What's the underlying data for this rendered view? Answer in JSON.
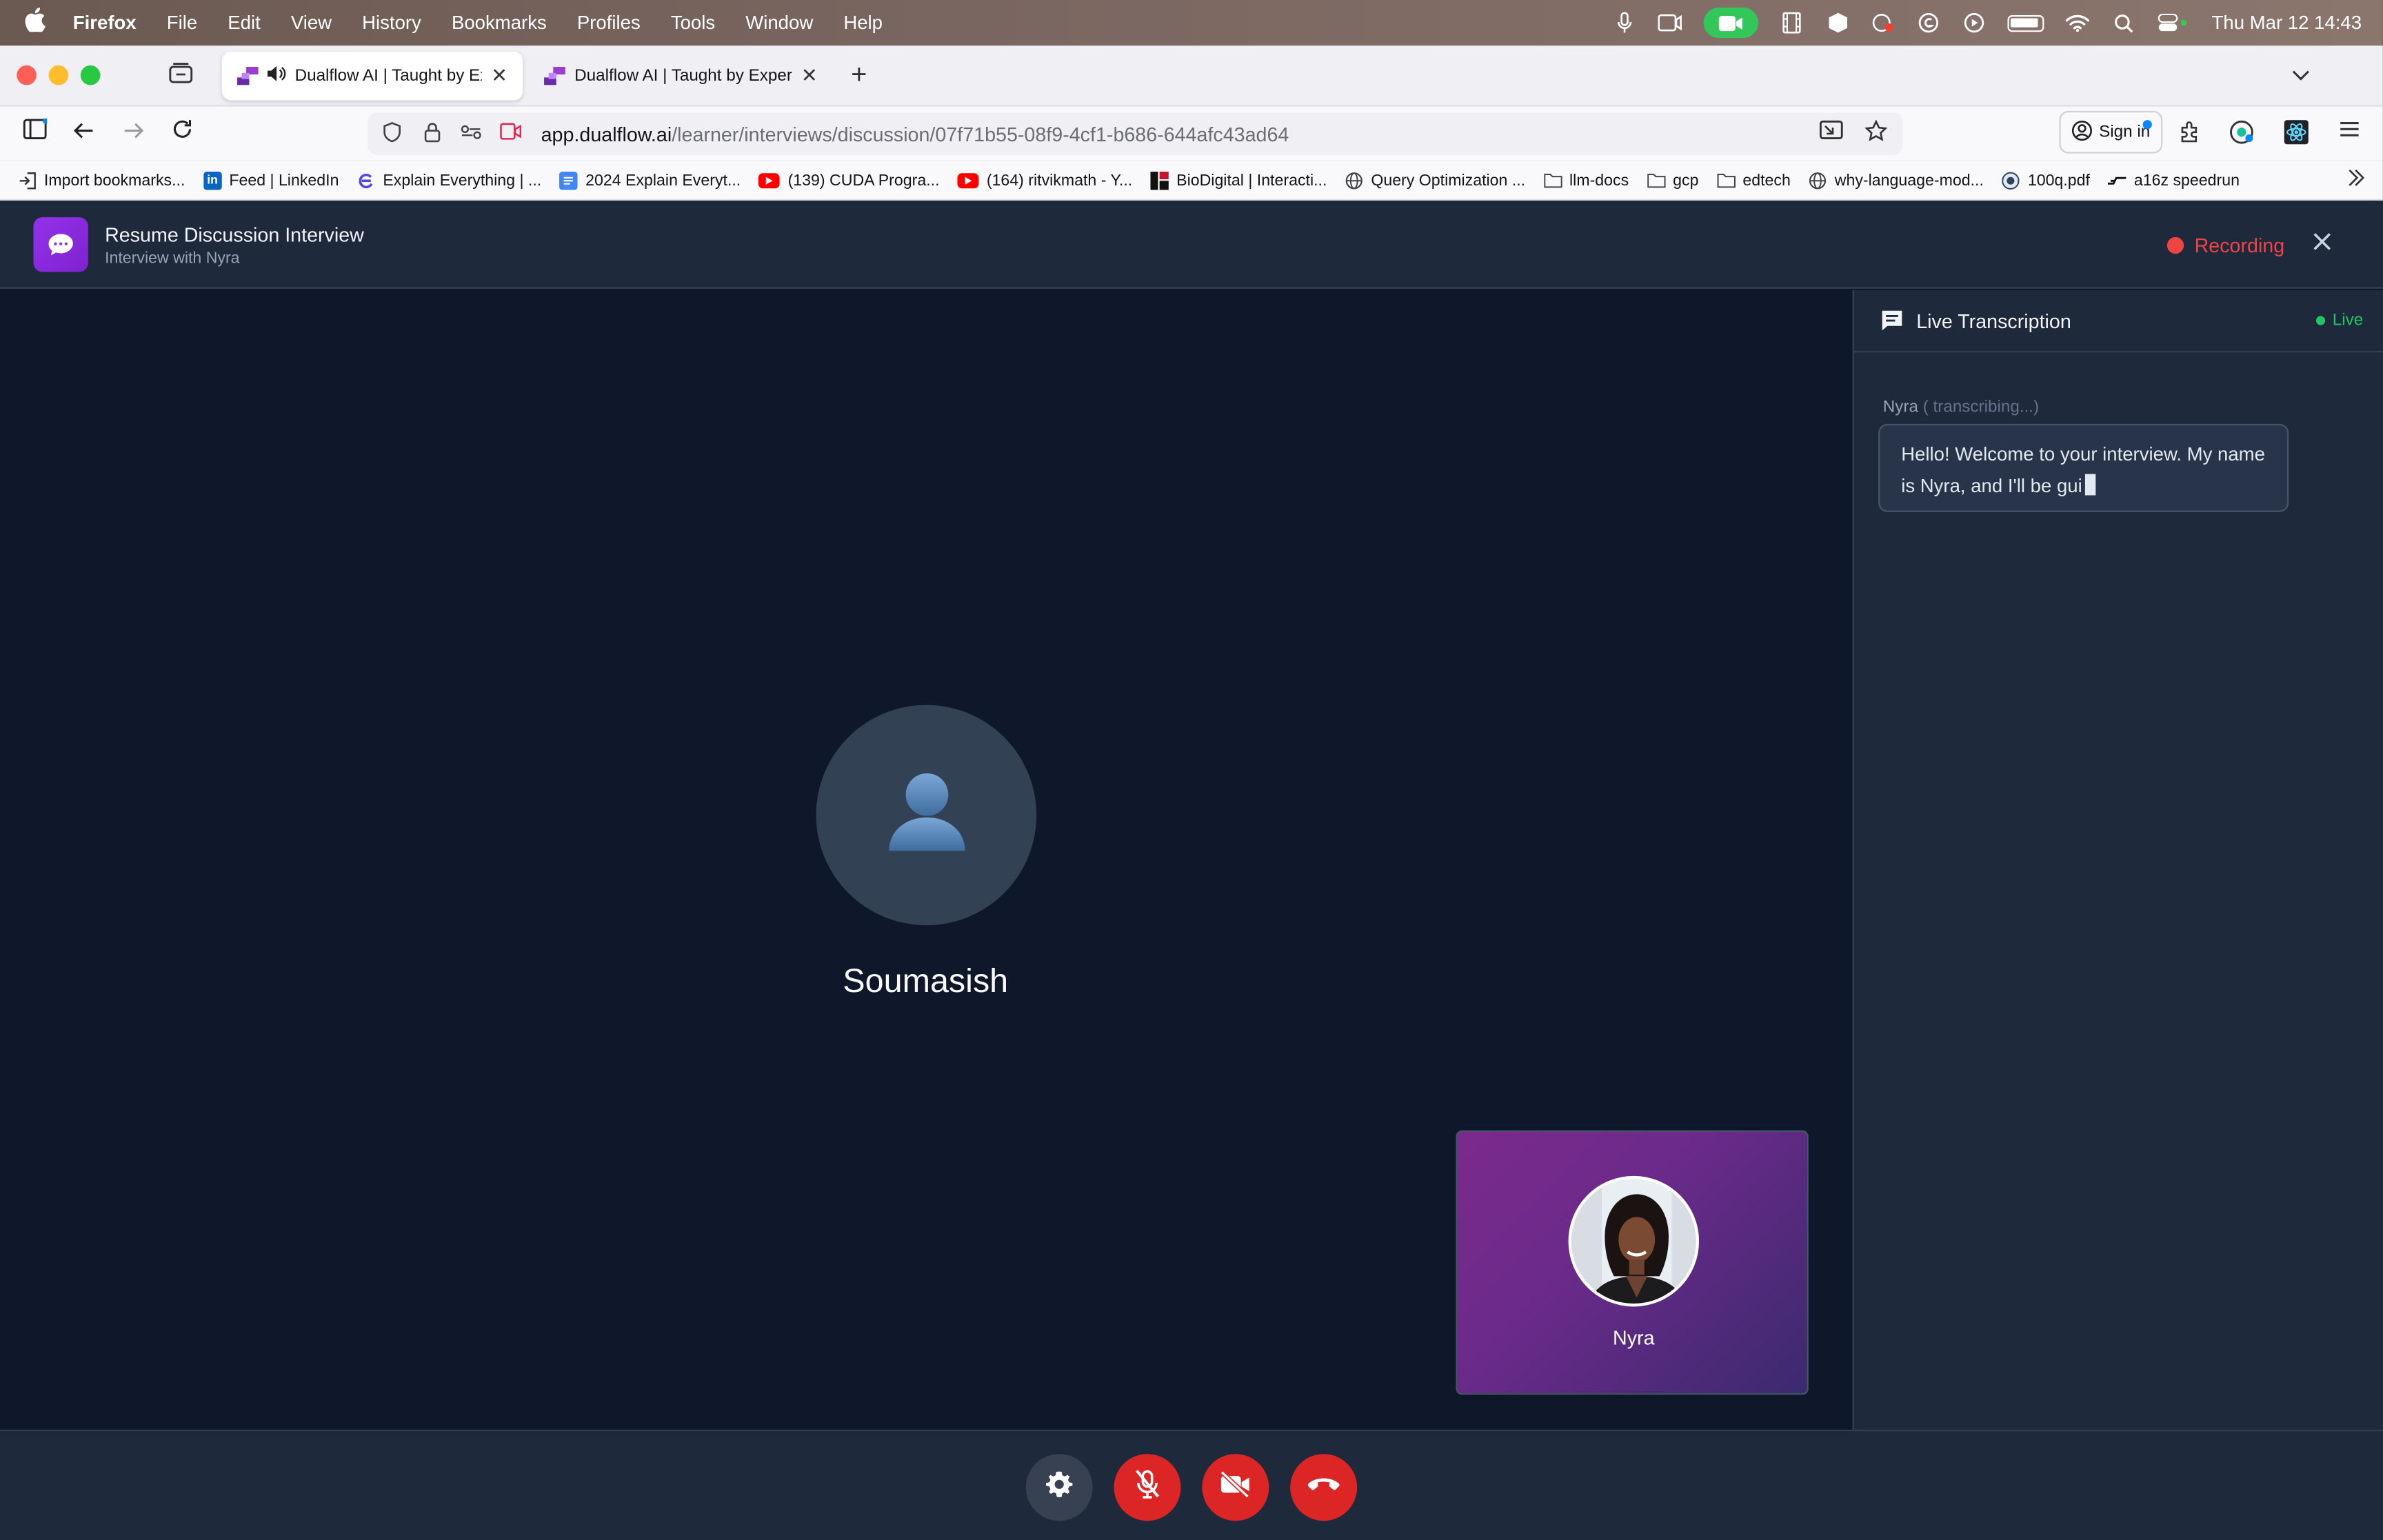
{
  "menubar": {
    "app": "Firefox",
    "items": [
      "File",
      "Edit",
      "View",
      "History",
      "Bookmarks",
      "Profiles",
      "Tools",
      "Window",
      "Help"
    ],
    "clock": "Thu Mar 12  14:43"
  },
  "browser": {
    "tabs": [
      {
        "title": "Dualflow AI | Taught by Experts, Powered by AI",
        "active": true
      },
      {
        "title": "Dualflow AI | Taught by Experts, Powered by AI",
        "active": false
      }
    ],
    "url_scheme_host": "app.dualflow.ai",
    "url_path": "/learner/interviews/discussion/07f71b55-08f9-4cf1-b686-644afc43ad64",
    "sign_in": "Sign in",
    "bookmarks": [
      {
        "label": "Import bookmarks...",
        "icon": "import-icon",
        "color": "#333333"
      },
      {
        "label": "Feed | LinkedIn",
        "icon": "linkedin-icon",
        "color": "#0a66c2"
      },
      {
        "label": "Explain Everything | ...",
        "icon": "explain-everything-icon",
        "color": "#4f46e5"
      },
      {
        "label": "2024 Explain Everyt...",
        "icon": "docs-icon",
        "color": "#4285f4"
      },
      {
        "label": "(139) CUDA Progra...",
        "icon": "youtube-icon",
        "color": "#ff0000"
      },
      {
        "label": "(164) ritvikmath - Y...",
        "icon": "youtube-icon",
        "color": "#ff0000"
      },
      {
        "label": "BioDigital | Interacti...",
        "icon": "biodigital-icon",
        "color": "#c8102e"
      },
      {
        "label": "Query Optimization ...",
        "icon": "globe-icon",
        "color": "#555555"
      },
      {
        "label": "llm-docs",
        "icon": "folder-icon",
        "color": "#555555"
      },
      {
        "label": "gcp",
        "icon": "folder-icon",
        "color": "#555555"
      },
      {
        "label": "edtech",
        "icon": "folder-icon",
        "color": "#555555"
      },
      {
        "label": "why-language-mod...",
        "icon": "globe-icon",
        "color": "#555555"
      },
      {
        "label": "100q.pdf",
        "icon": "pdf-seal-icon",
        "color": "#334155"
      },
      {
        "label": "a16z speedrun",
        "icon": "speedrun-icon",
        "color": "#111111"
      }
    ]
  },
  "app": {
    "title": "Resume Discussion Interview",
    "subtitle": "Interview with Nyra",
    "recording_label": "Recording",
    "user_name": "Soumasish",
    "interviewer_name": "Nyra",
    "accent": "#9333ea",
    "record_color": "#ef4444"
  },
  "transcription": {
    "title": "Live Transcription",
    "live_label": "Live",
    "entries": [
      {
        "speaker": "Nyra",
        "status": "( transcribing...)",
        "text": "Hello! Welcome to your interview. My name is Nyra, and I'll be gui"
      }
    ]
  },
  "controls": [
    {
      "name": "settings-button",
      "icon": "gear-icon"
    },
    {
      "name": "mic-toggle-button",
      "icon": "mic-off-icon"
    },
    {
      "name": "camera-toggle-button",
      "icon": "video-off-icon"
    },
    {
      "name": "end-call-button",
      "icon": "phone-hangup-icon"
    }
  ]
}
